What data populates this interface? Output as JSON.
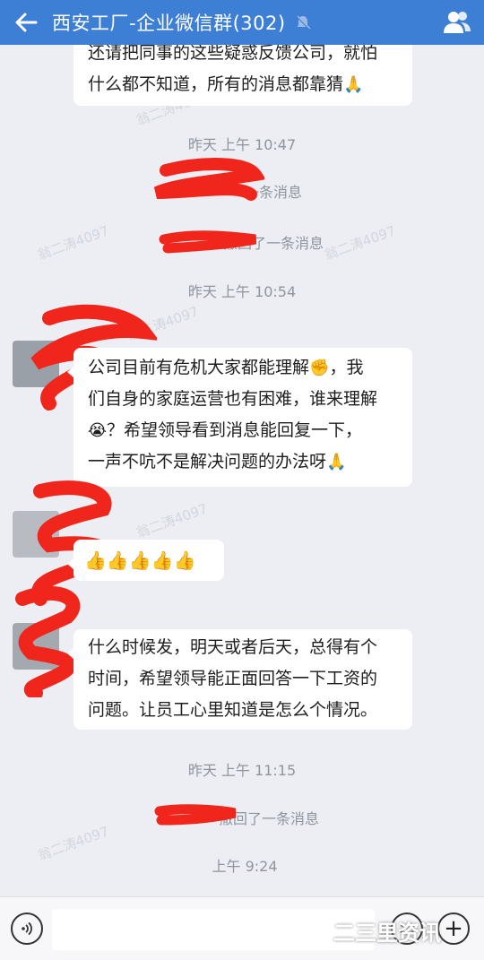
{
  "header": {
    "title": "西安工厂-企业微信群(302)",
    "back_icon": "back-arrow-icon",
    "mute_icon": "bell-muted-icon",
    "members_icon": "group-members-icon",
    "bg_color": "#3d7fd4"
  },
  "messages": [
    {
      "type": "text",
      "lines": [
        "还请把同事的这些疑惑反馈公司，就怕",
        "什么都不知道，所有的消息都靠猜"
      ],
      "trailing_emoji": "🙏"
    },
    {
      "type": "time",
      "text": "昨天 上午 10:47"
    },
    {
      "type": "system",
      "text": "一条消息"
    },
    {
      "type": "system",
      "text": "撤回了一条消息"
    },
    {
      "type": "time",
      "text": "昨天 上午 10:54"
    },
    {
      "type": "text",
      "lines": [
        "公司目前有危机大家都能理解",
        "们自身的家庭运营也有困难，谁来理解",
        "？希望领导看到消息能回复一下，",
        "一声不吭不是解决问题的办法呀"
      ],
      "emojis": [
        "✊",
        "，我",
        "😭",
        "🙏"
      ]
    },
    {
      "type": "emoji",
      "text": "👍👍👍👍👍"
    },
    {
      "type": "text",
      "lines": [
        "什么时候发，明天或者后天，总得有个",
        "时间，希望领导能正面回答一下工资的",
        "问题。让员工心里知道是怎么个情况。"
      ]
    },
    {
      "type": "time",
      "text": "昨天 上午 11:15"
    },
    {
      "type": "system",
      "text": "撤回了一条消息"
    },
    {
      "type": "time",
      "text": "上午 9:24"
    }
  ],
  "watermark": "翁二涛4097",
  "input": {
    "placeholder": "",
    "voice_icon": "voice-input-icon",
    "emoji_icon": "emoji-smiley-icon",
    "more_icon": "plus-more-icon"
  },
  "brand_overlay": "二三里资讯"
}
